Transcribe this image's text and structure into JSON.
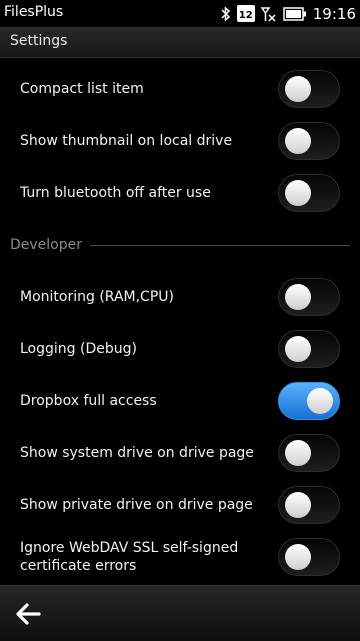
{
  "status": {
    "app_name": "FilesPlus",
    "time": "19:16",
    "calendar_day": "12"
  },
  "header": {
    "title": "Settings"
  },
  "settings_top": [
    {
      "label": "Compact list item",
      "on": false
    },
    {
      "label": "Show thumbnail on local drive",
      "on": false
    },
    {
      "label": "Turn bluetooth off after use",
      "on": false
    }
  ],
  "section": {
    "developer": "Developer"
  },
  "settings_dev": [
    {
      "label": "Monitoring (RAM,CPU)",
      "on": false
    },
    {
      "label": "Logging (Debug)",
      "on": false
    },
    {
      "label": "Dropbox full access",
      "on": true
    },
    {
      "label": "Show system drive on drive page",
      "on": false
    },
    {
      "label": "Show private drive on drive page",
      "on": false
    },
    {
      "label": "Ignore WebDAV SSL self-signed certificate errors",
      "on": false
    }
  ],
  "colors": {
    "toggle_on": "#2a86ea",
    "background": "#000000"
  },
  "toolbar": {
    "back_icon": "back-arrow-icon"
  }
}
